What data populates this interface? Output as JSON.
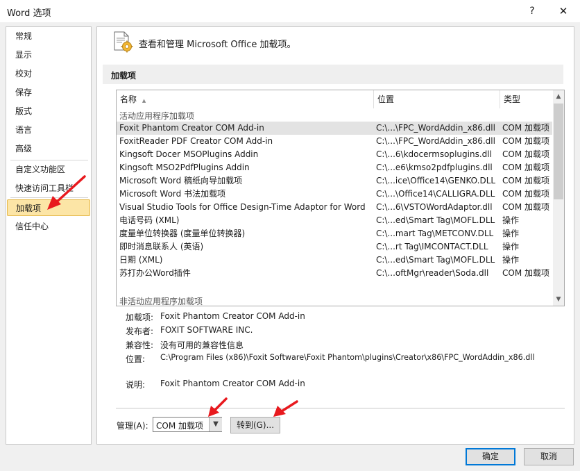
{
  "window": {
    "title": "Word 选项",
    "help": "?",
    "close": "✕"
  },
  "sidebar": {
    "items": [
      {
        "label": "常规"
      },
      {
        "label": "显示"
      },
      {
        "label": "校对"
      },
      {
        "label": "保存"
      },
      {
        "label": "版式"
      },
      {
        "label": "语言"
      },
      {
        "label": "高级"
      },
      {
        "label": "自定义功能区"
      },
      {
        "label": "快速访问工具栏"
      },
      {
        "label": "加载项"
      },
      {
        "label": "信任中心"
      }
    ]
  },
  "header": {
    "text": "查看和管理 Microsoft Office 加载项。"
  },
  "section": {
    "title": "加载项"
  },
  "list": {
    "columns": {
      "name": "名称",
      "location": "位置",
      "type": "类型",
      "sort_arrow": "▲"
    },
    "group_active": "活动应用程序加载项",
    "group_inactive": "非活动应用程序加载项",
    "rows": [
      {
        "name": "Foxit Phantom Creator COM Add-in",
        "location": "C:\\...\\FPC_WordAddin_x86.dll",
        "type": "COM 加载项"
      },
      {
        "name": "FoxitReader PDF Creator COM Add-in",
        "location": "C:\\...\\FPC_WordAddin_x86.dll",
        "type": "COM 加载项"
      },
      {
        "name": "Kingsoft Docer MSOPlugins Addin",
        "location": "C:\\...6\\kdocermsoplugins.dll",
        "type": "COM 加载项"
      },
      {
        "name": "Kingsoft MSO2PdfPlugins Addin",
        "location": "C:\\...e6\\kmso2pdfplugins.dll",
        "type": "COM 加载项"
      },
      {
        "name": "Microsoft Word 稿纸向导加载项",
        "location": "C:\\...ice\\Office14\\GENKO.DLL",
        "type": "COM 加载项"
      },
      {
        "name": "Microsoft Word 书法加载项",
        "location": "C:\\...\\Office14\\CALLIGRA.DLL",
        "type": "COM 加载项"
      },
      {
        "name": "Visual Studio Tools for Office Design-Time Adaptor for Word",
        "location": "C:\\...6\\VSTOWordAdaptor.dll",
        "type": "COM 加载项"
      },
      {
        "name": "电话号码 (XML)",
        "location": "C:\\...ed\\Smart Tag\\MOFL.DLL",
        "type": "操作"
      },
      {
        "name": "度量单位转换器 (度量单位转换器)",
        "location": "C:\\...mart Tag\\METCONV.DLL",
        "type": "操作"
      },
      {
        "name": "即时消息联系人 (英语)",
        "location": "C:\\...rt Tag\\IMCONTACT.DLL",
        "type": "操作"
      },
      {
        "name": "日期 (XML)",
        "location": "C:\\...ed\\Smart Tag\\MOFL.DLL",
        "type": "操作"
      },
      {
        "name": "苏打办公Word插件",
        "location": "C:\\...oftMgr\\reader\\Soda.dll",
        "type": "COM 加载项"
      }
    ]
  },
  "details": {
    "addin_label": "加载项:",
    "addin_value": "Foxit Phantom Creator COM Add-in",
    "publisher_label": "发布者:",
    "publisher_value": "FOXIT SOFTWARE INC.",
    "compat_label": "兼容性:",
    "compat_value": "没有可用的兼容性信息",
    "location_label": "位置:",
    "location_value": "C:\\Program Files (x86)\\Foxit Software\\Foxit Phantom\\plugins\\Creator\\x86\\FPC_WordAddin_x86.dll",
    "desc_label": "说明:",
    "desc_value": "Foxit Phantom Creator COM Add-in"
  },
  "manage": {
    "label": "管理(A):",
    "value": "COM 加载项",
    "goto": "转到(G)..."
  },
  "footer": {
    "ok": "确定",
    "cancel": "取消"
  },
  "colors": {
    "selected_bg": "#fce5a6",
    "accent": "#0078d7",
    "annotation_arrow": "#e8191e"
  }
}
